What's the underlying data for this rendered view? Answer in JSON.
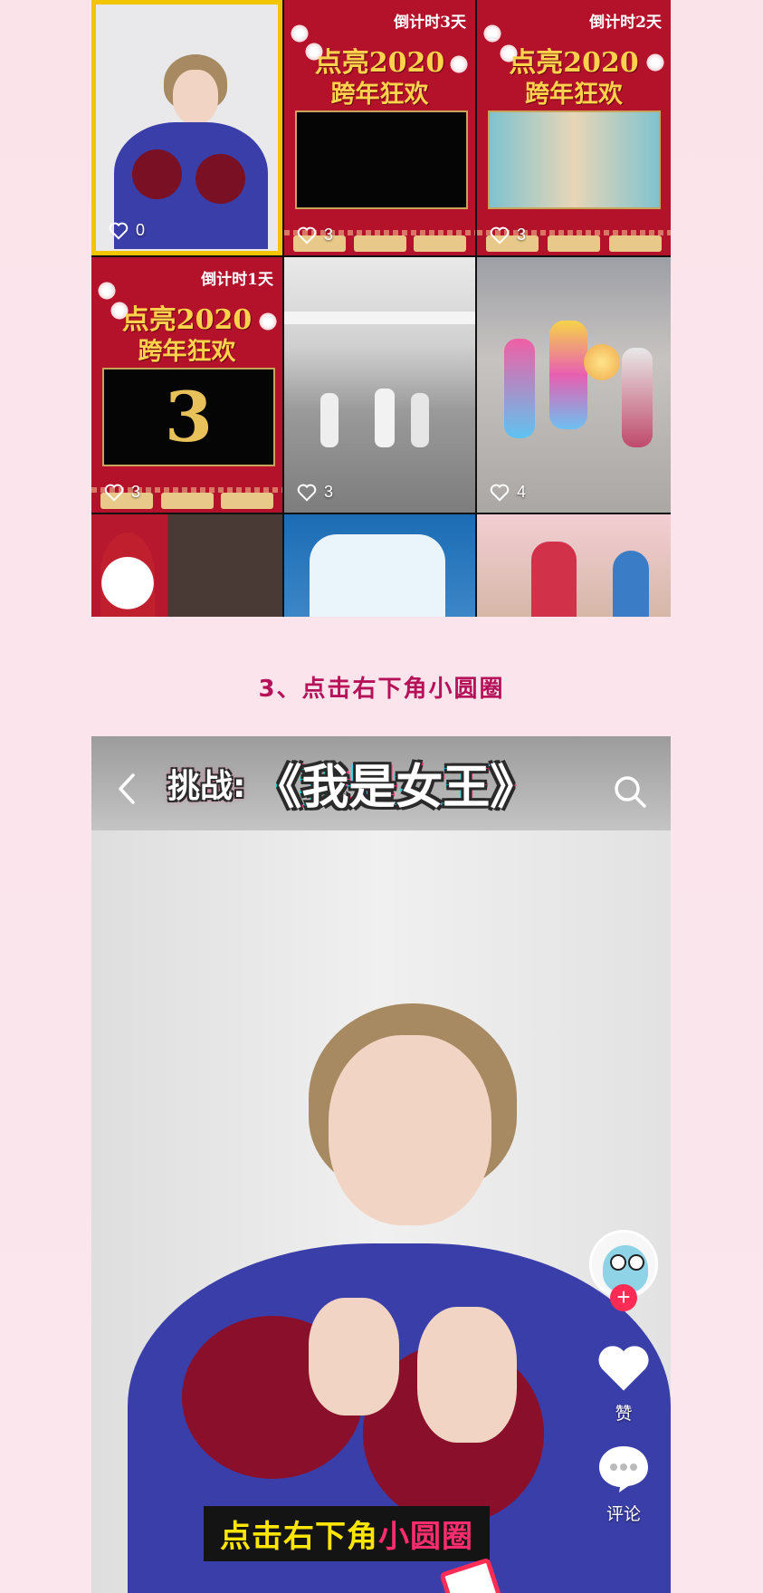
{
  "grid": {
    "cells": [
      {
        "likes": "0"
      },
      {
        "countdown": "倒计时3天",
        "title1": "点亮2020",
        "title2": "跨年狂欢",
        "likes": "3"
      },
      {
        "countdown": "倒计时2天",
        "title1": "点亮2020",
        "title2": "跨年狂欢",
        "likes": "3"
      },
      {
        "countdown": "倒计时1天",
        "title1": "点亮2020",
        "title2": "跨年狂欢",
        "screen_text": "3",
        "likes": "3"
      },
      {
        "likes": "3"
      },
      {
        "likes": "4"
      }
    ]
  },
  "step": {
    "text": "3、点击右下角小圆圈"
  },
  "video": {
    "challenge_label": "挑战:",
    "challenge_title": "《我是女王》",
    "side": {
      "like_label": "赞",
      "comment_label": "评论"
    },
    "tip_part1": "点击右下角",
    "tip_part2": "小圆圈"
  },
  "colors": {
    "accent": "#b5125a",
    "poster_red": "#b3122a",
    "tip_yellow": "#ffe600",
    "tip_pink": "#ff2d6f",
    "selected_border": "#f2c500"
  }
}
